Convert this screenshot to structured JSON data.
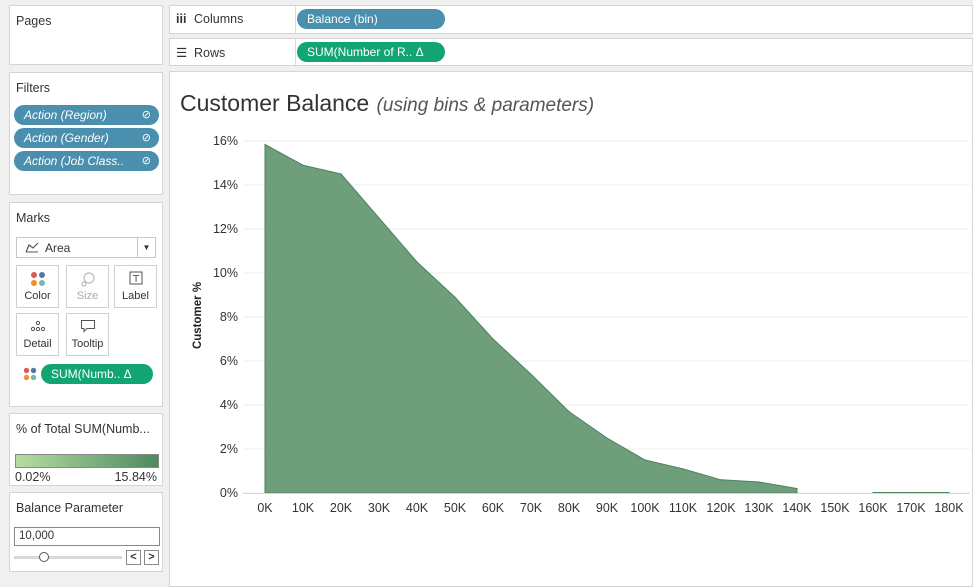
{
  "pages": {
    "title": "Pages"
  },
  "filters": {
    "title": "Filters",
    "items": [
      {
        "label": "Action (Region)"
      },
      {
        "label": "Action (Gender)"
      },
      {
        "label": "Action (Job Class.."
      }
    ]
  },
  "marks": {
    "title": "Marks",
    "type": "Area",
    "buttons": {
      "color": "Color",
      "size": "Size",
      "label": "Label",
      "detail": "Detail",
      "tooltip": "Tooltip"
    },
    "field_pill": "SUM(Numb..  Δ"
  },
  "legend": {
    "title": "% of Total SUM(Numb...",
    "min": "0.02%",
    "max": "15.84%",
    "color_low": "#b5dda0",
    "color_high": "#4d8a5e"
  },
  "parameter": {
    "title": "Balance Parameter",
    "value": "10,000",
    "prev": "<",
    "next": ">"
  },
  "shelves": {
    "columns_label": "Columns",
    "columns_pill": "Balance (bin)",
    "rows_label": "Rows",
    "rows_pill": "SUM(Number of R..  Δ"
  },
  "chart": {
    "title": "Customer Balance",
    "subtitle": "(using bins & parameters)"
  },
  "chart_data": {
    "type": "area",
    "title": "Customer Balance",
    "subtitle": "(using bins & parameters)",
    "ylabel": "Customer %",
    "xlabel": "",
    "x": [
      "0K",
      "10K",
      "20K",
      "30K",
      "40K",
      "50K",
      "60K",
      "70K",
      "80K",
      "90K",
      "100K",
      "110K",
      "120K",
      "130K",
      "140K",
      "150K",
      "160K",
      "170K",
      "180K"
    ],
    "series": [
      {
        "values": [
          15.84,
          14.9,
          14.5,
          12.5,
          10.5,
          8.9,
          7.0,
          5.4,
          3.7,
          2.5,
          1.5,
          1.1,
          0.6,
          0.5,
          0.2,
          null,
          0.02,
          0.02,
          0.02
        ]
      }
    ],
    "yticks": [
      "0%",
      "2%",
      "4%",
      "6%",
      "8%",
      "10%",
      "12%",
      "14%",
      "16%"
    ],
    "ylim": [
      0,
      16
    ],
    "fill_color": "#6f9e7b",
    "line_color": "#4e8060",
    "grid": true
  }
}
